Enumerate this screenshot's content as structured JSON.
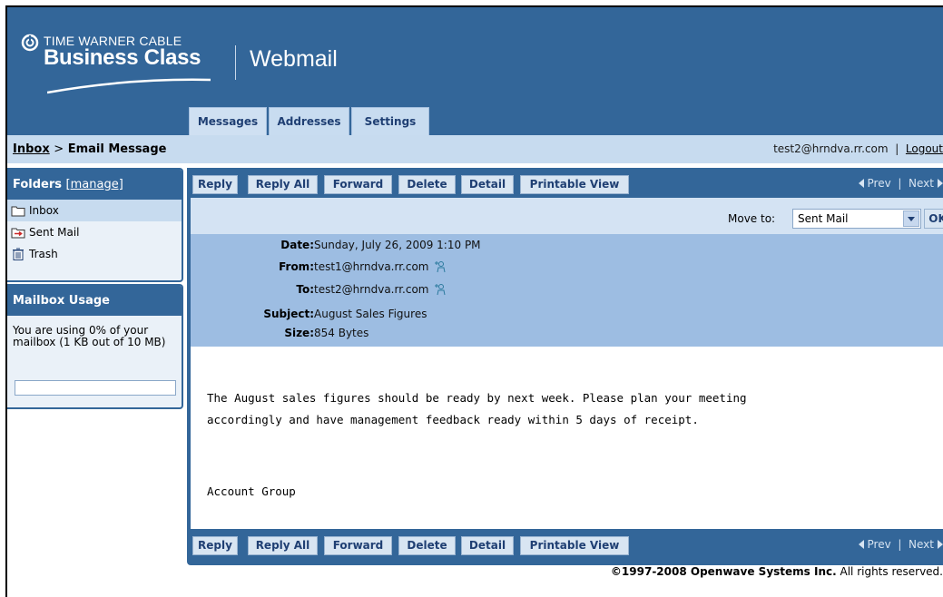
{
  "brand": {
    "top": "TIME WARNER CABLE",
    "main": "Business Class",
    "product": "Webmail"
  },
  "tabs": [
    {
      "label": "Messages",
      "active": true
    },
    {
      "label": "Addresses",
      "active": false
    },
    {
      "label": "Settings",
      "active": false
    }
  ],
  "breadcrumb": {
    "inbox": "Inbox",
    "separator": ">",
    "current": "Email Message"
  },
  "user": {
    "email": "test2@hrndva.rr.com",
    "separator": "|",
    "logout": "Logout"
  },
  "sidebar": {
    "folders_title": "Folders",
    "manage_label": "[manage]",
    "folders": [
      {
        "name": "Inbox",
        "icon": "folder-icon",
        "active": true
      },
      {
        "name": "Sent Mail",
        "icon": "sent-folder-icon",
        "active": false
      },
      {
        "name": "Trash",
        "icon": "trash-icon",
        "active": false
      }
    ],
    "usage_title": "Mailbox Usage",
    "usage_text": "You are using 0% of your mailbox (1 KB out of 10 MB)",
    "usage_percent": 0
  },
  "toolbar": {
    "reply": "Reply",
    "reply_all": "Reply All",
    "forward": "Forward",
    "delete": "Delete",
    "detail": "Detail",
    "printable_view": "Printable View",
    "prev": "Prev",
    "pager_separator": "|",
    "next": "Next"
  },
  "move": {
    "label": "Move to:",
    "selected": "Sent Mail",
    "ok": "OK"
  },
  "message": {
    "date_label": "Date:",
    "date": "Sunday, July 26, 2009 1:10 PM",
    "from_label": "From:",
    "from": "test1@hrndva.rr.com",
    "to_label": "To:",
    "to": "test2@hrndva.rr.com",
    "subject_label": "Subject:",
    "subject": "August Sales Figures",
    "size_label": "Size:",
    "size": "854 Bytes",
    "body_lines": [
      "The August sales figures should be ready by next week. Please plan your meeting",
      "accordingly and have management feedback ready within 5 days of receipt.",
      "Account Group"
    ]
  },
  "footer": {
    "copyright": "©1997-2008 Openwave Systems Inc.",
    "rights": "All rights reserved."
  },
  "colors": {
    "primary": "#336699",
    "light": "#c7dbef",
    "header_band": "#9dbde2"
  }
}
